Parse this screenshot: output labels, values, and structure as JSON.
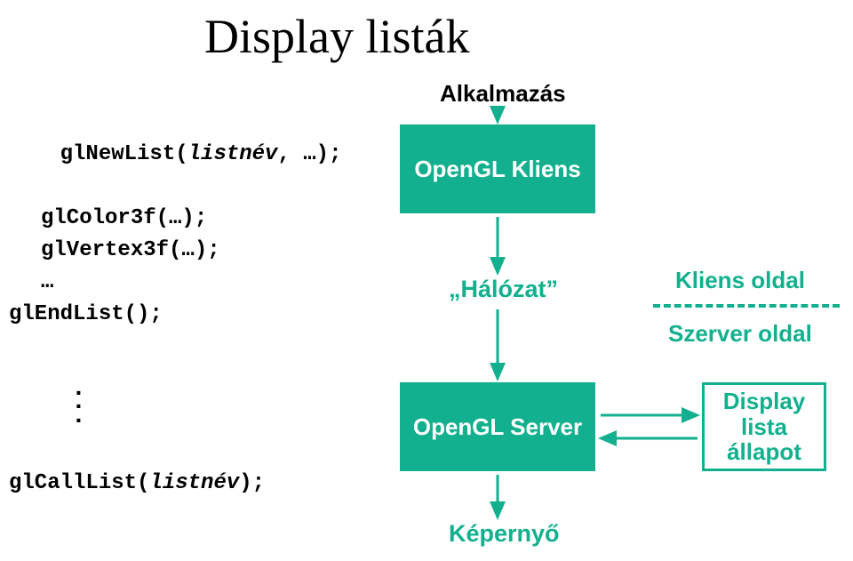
{
  "title": "Display listák",
  "code": {
    "line1_pre": "glNewList(",
    "line1_arg": "listnév",
    "line1_post": ", …);",
    "line2": "glColor3f(…);",
    "line3": "glVertex3f(…);",
    "line4": "…",
    "line5": "glEndList();",
    "call_pre": "glCallList(",
    "call_arg": "listnév",
    "call_post": ");"
  },
  "labels": {
    "alkalmazas": "Alkalmazás",
    "kliens": "OpenGL Kliens",
    "halozat": "„Hálózat”",
    "server": "OpenGL Server",
    "kepernyo": "Képernyő",
    "kliens_oldal": "Kliens oldal",
    "szerver_oldal": "Szerver oldal",
    "state": "Display\nlista\nállapot"
  },
  "colors": {
    "accent": "#12b08e"
  }
}
